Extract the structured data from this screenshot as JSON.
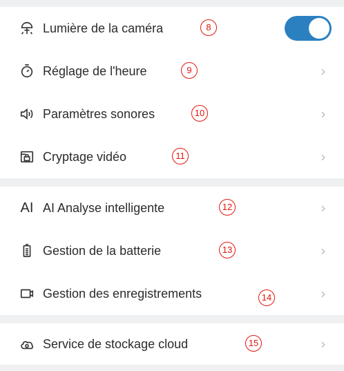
{
  "group1": [
    {
      "label": "Lumière de la caméra",
      "num": "8",
      "icon": "camera-light-icon",
      "control": "toggle",
      "toggle_on": true
    },
    {
      "label": "Réglage de l'heure",
      "num": "9",
      "icon": "timer-icon",
      "control": "chevron"
    },
    {
      "label": "Paramètres sonores",
      "num": "10",
      "icon": "speaker-icon",
      "control": "chevron"
    },
    {
      "label": "Cryptage vidéo",
      "num": "11",
      "icon": "encryption-icon",
      "control": "chevron"
    }
  ],
  "group2": [
    {
      "label": "AI Analyse intelligente",
      "num": "12",
      "icon": "ai-icon",
      "icon_text": "AI",
      "control": "chevron"
    },
    {
      "label": "Gestion de la batterie",
      "num": "13",
      "icon": "battery-icon",
      "control": "chevron"
    },
    {
      "label": "Gestion des enregistrements",
      "num": "14",
      "icon": "record-icon",
      "control": "chevron"
    }
  ],
  "group3": [
    {
      "label": "Service de stockage cloud",
      "num": "15",
      "icon": "cloud-storage-icon",
      "control": "chevron"
    }
  ],
  "chevron_glyph": "›",
  "colors": {
    "toggle": "#2b80c0",
    "annotation": "#e3150d",
    "background": "#eef0f2"
  }
}
